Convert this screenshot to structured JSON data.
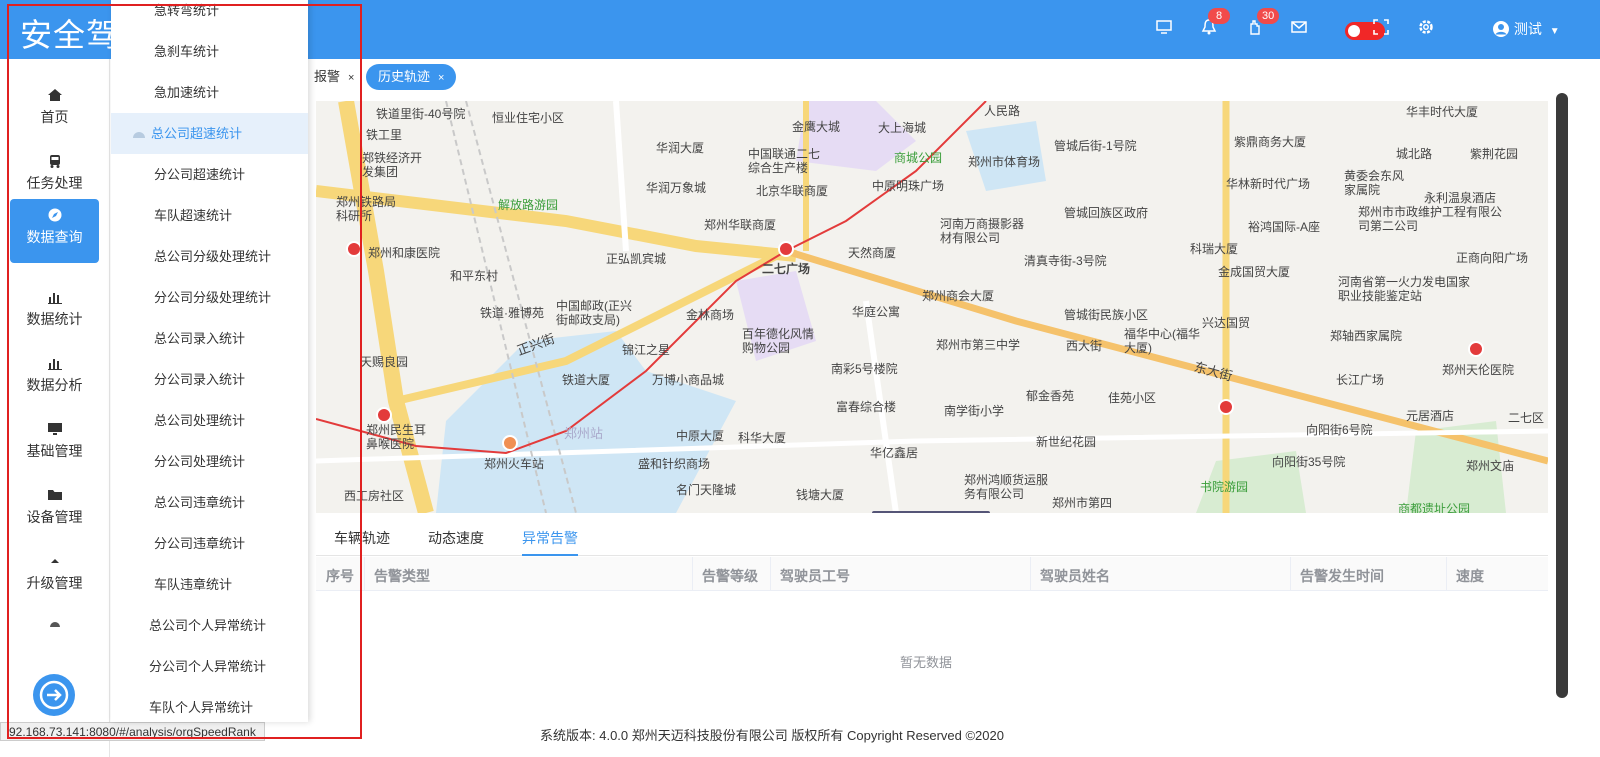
{
  "header": {
    "app_title": "安全驾驶",
    "badges": {
      "notifications": "8",
      "tasks": "30"
    },
    "user_name": "测试"
  },
  "sidebar": {
    "items": [
      {
        "label": "首页",
        "icon": "home-icon"
      },
      {
        "label": "任务处理",
        "icon": "bus-icon"
      },
      {
        "label": "数据查询",
        "icon": "compass-icon"
      },
      {
        "label": "数据统计",
        "icon": "bar-chart-icon"
      },
      {
        "label": "数据分析",
        "icon": "bar-chart-icon"
      },
      {
        "label": "基础管理",
        "icon": "monitor-icon"
      },
      {
        "label": "设备管理",
        "icon": "folder-icon"
      },
      {
        "label": "升级管理",
        "icon": "caret-up-icon"
      }
    ]
  },
  "submenu": {
    "items": [
      "急转弯统计",
      "急刹车统计",
      "急加速统计",
      "总公司超速统计",
      "分公司超速统计",
      "车队超速统计",
      "总公司分级处理统计",
      "分公司分级处理统计",
      "总公司录入统计",
      "分公司录入统计",
      "总公司处理统计",
      "分公司处理统计",
      "总公司违章统计",
      "分公司违章统计",
      "车队违章统计",
      "总公司个人异常统计",
      "分公司个人异常统计",
      "车队个人异常统计"
    ]
  },
  "tabs": {
    "alarm_partial": "报警",
    "history": "历史轨迹",
    "close": "×"
  },
  "map": {
    "labels": [
      "铁道里街-40号院",
      "恒业住宅小区",
      "金鹰大城",
      "大上海城",
      "人民路",
      "华丰时代大厦",
      "铁工里",
      "华润大厦",
      "中国联通二七综合生产楼",
      "商城公园",
      "郑州市体育场",
      "管城后街-1号院",
      "紫鼎商务大厦",
      "郑铁经济开发集团",
      "华润万象城",
      "北京华联商厦",
      "中原明珠广场",
      "城北路",
      "紫荆花园",
      "郑州铁路局科研所",
      "解放路游园",
      "郑州华联商厦",
      "河南万商摄影器材有限公司",
      "管城回族区政府",
      "华林新时代广场",
      "黄委会东风家属院",
      "永利温泉酒店",
      "郑州市市政维护工程有限公司第二公司",
      "郑州和康医院",
      "正弘凯宾城",
      "二七广场",
      "天然商厦",
      "清真寺街-3号院",
      "科瑞大厦",
      "裕鸿国际-A座",
      "正商向阳广场",
      "和平东村",
      "金成国贸大厦",
      "河南省第一火力发电国家职业技能鉴定站",
      "郑州商会大厦",
      "华庭公寓",
      "铁道·雅博苑",
      "中国邮政(正兴街邮政支局)",
      "金林商场",
      "管城街民族小区",
      "兴达国贸",
      "正兴街",
      "百年德化风情购物公园",
      "锦江之星",
      "郑州市第三中学",
      "西大街",
      "福华中心(福华大厦)",
      "郑轴西家属院",
      "郑州天伦医院",
      "天赐良园",
      "铁道大厦",
      "万博小商品城",
      "南彩5号楼院",
      "东大街",
      "长江广场",
      "郁金香苑",
      "佳苑小区",
      "富春综合楼",
      "南学街小学",
      "元居酒店",
      "二七区",
      "郑州民生耳鼻喉医院",
      "郑州站",
      "中原大厦",
      "科华大厦",
      "新世纪花园",
      "向阳街6号院",
      "郑州火车站",
      "华亿鑫居",
      "盛和针织商场",
      "郑州鸿顺货运服务有限公司",
      "向阳街35号院",
      "郑州文庙",
      "西工房社区",
      "名门天隆城",
      "钱塘大厦",
      "书院游园",
      "商都遗址公园",
      "郑州市第四"
    ]
  },
  "bottom": {
    "subtabs": [
      "车辆轨迹",
      "动态速度",
      "异常告警"
    ],
    "columns": [
      "序号",
      "告警类型",
      "告警等级",
      "驾驶员工号",
      "驾驶员姓名",
      "告警发生时间",
      "速度"
    ],
    "empty_text": "暂无数据"
  },
  "footer": {
    "text": "系统版本: 4.0.0 郑州天迈科技股份有限公司 版权所有 Copyright Reserved ©2020"
  },
  "status_url": "92.168.73.141:8080/#/analysis/orgSpeedRank",
  "colors": {
    "primary": "#3b95ee",
    "badge": "#f14b4b",
    "annotation": "#e02020"
  }
}
